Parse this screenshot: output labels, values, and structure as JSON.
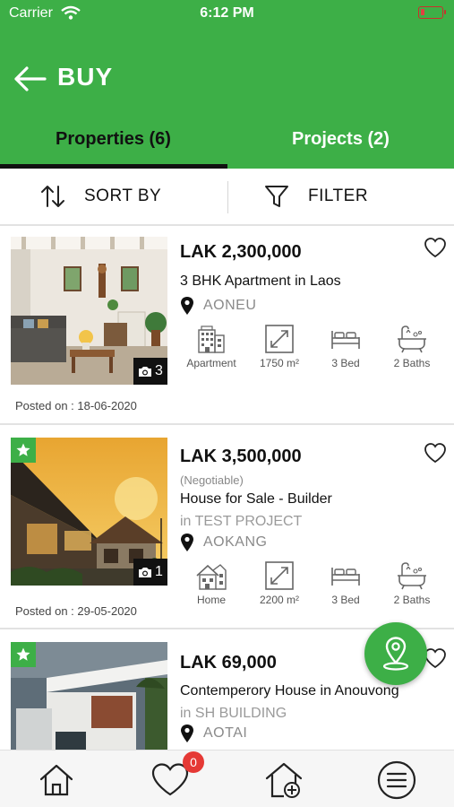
{
  "status_bar": {
    "carrier": "Carrier",
    "time": "6:12 PM"
  },
  "header": {
    "title": "BUY",
    "back_icon": "arrow-left-icon"
  },
  "tabs": [
    {
      "label": "Properties (6)",
      "active": true
    },
    {
      "label": "Projects (2)",
      "active": false
    }
  ],
  "toolbar": {
    "sort_label": "SORT BY",
    "filter_label": "FILTER"
  },
  "listings": [
    {
      "price": "LAK 2,300,000",
      "title": "3 BHK Apartment in Laos",
      "location": "AONEU",
      "photo_count": "3",
      "featured": false,
      "features": {
        "type": "Apartment",
        "area": "1750  m²",
        "beds": "3  Bed",
        "baths": "2  Baths"
      },
      "posted": "Posted on : 18-06-2020"
    },
    {
      "price": "LAK 3,500,000",
      "negotiable": "(Negotiable)",
      "title": "House for Sale - Builder",
      "project": "in TEST PROJECT",
      "location": "AOKANG",
      "photo_count": "1",
      "featured": true,
      "features": {
        "type": "Home",
        "area": "2200  m²",
        "beds": "3  Bed",
        "baths": "2  Baths"
      },
      "posted": "Posted on : 29-05-2020"
    },
    {
      "price": "LAK 69,000",
      "title": "Contemperory House in Anouvong",
      "project": "in SH BUILDING",
      "location": "AOTAI",
      "featured": true
    }
  ],
  "bottom_nav": {
    "items": [
      "home-icon",
      "favorites-icon",
      "add-property-icon",
      "menu-icon"
    ],
    "favorites_count": "0"
  },
  "colors": {
    "brand": "#3daf47",
    "badge": "#e53935"
  }
}
